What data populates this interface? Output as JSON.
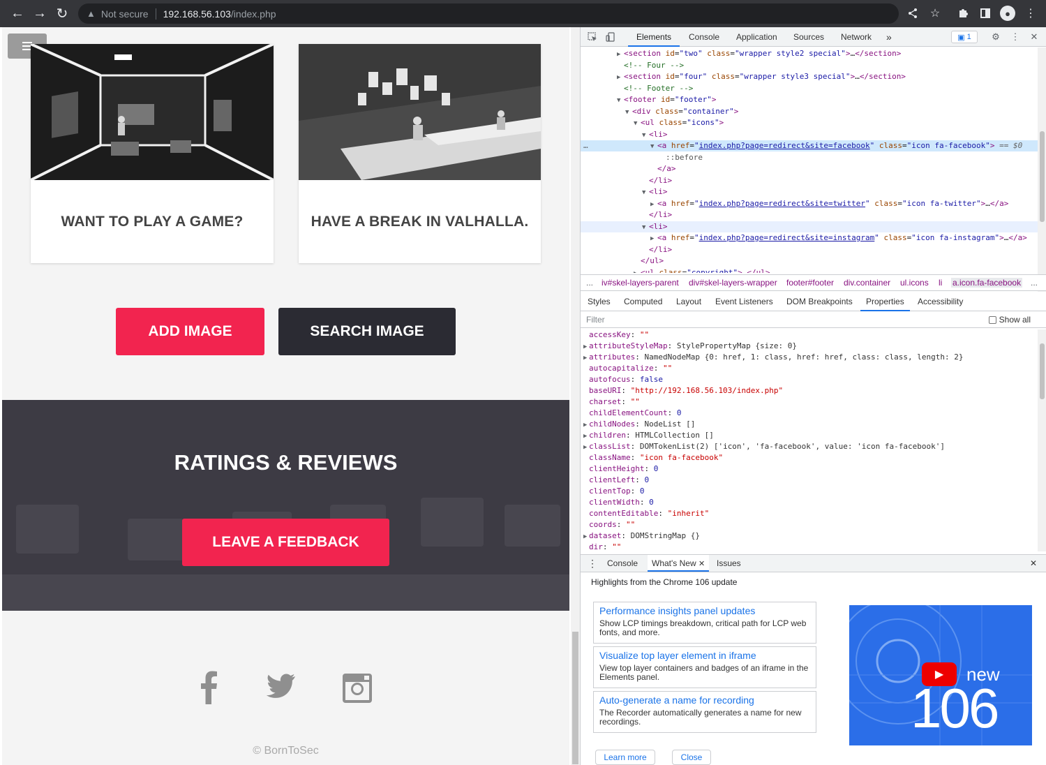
{
  "browser": {
    "security_warning": "Not secure",
    "url_host": "192.168.56.103",
    "url_path": "/index.php"
  },
  "page": {
    "cards": [
      {
        "title": "WANT TO PLAY A GAME?"
      },
      {
        "title": "HAVE A BREAK IN VALHALLA."
      }
    ],
    "add_image_label": "ADD IMAGE",
    "search_image_label": "SEARCH IMAGE",
    "reviews_title": "RATINGS & REVIEWS",
    "feedback_label": "LEAVE A FEEDBACK",
    "copyright": "© BornToSec",
    "colors": {
      "accent": "#f2244f",
      "dark": "#2b2b33"
    }
  },
  "devtools": {
    "tabs": [
      "Elements",
      "Console",
      "Application",
      "Sources",
      "Network",
      "»"
    ],
    "issues_count": "1",
    "breadcrumbs": [
      "...",
      "iv#skel-layers-parent",
      "div#skel-layers-wrapper",
      "footer#footer",
      "div.container",
      "ul.icons",
      "li",
      "a.icon.fa-facebook",
      "..."
    ],
    "subtabs": [
      "Styles",
      "Computed",
      "Layout",
      "Event Listeners",
      "DOM Breakpoints",
      "Properties",
      "Accessibility"
    ],
    "filter_placeholder": "Filter",
    "show_all": "Show all",
    "props": [
      {
        "k": "accessKey",
        "v": "\"\"",
        "t": "s",
        "exp": false
      },
      {
        "k": "attributeStyleMap",
        "v": "StylePropertyMap {size: 0}",
        "t": "o",
        "exp": true
      },
      {
        "k": "attributes",
        "v": "NamedNodeMap {0: href, 1: class, href: href, class: class, length: 2}",
        "t": "o",
        "exp": true
      },
      {
        "k": "autocapitalize",
        "v": "\"\"",
        "t": "s",
        "exp": false
      },
      {
        "k": "autofocus",
        "v": "false",
        "t": "n",
        "exp": false
      },
      {
        "k": "baseURI",
        "v": "\"http://192.168.56.103/index.php\"",
        "t": "s",
        "exp": false
      },
      {
        "k": "charset",
        "v": "\"\"",
        "t": "s",
        "exp": false
      },
      {
        "k": "childElementCount",
        "v": "0",
        "t": "n",
        "exp": false
      },
      {
        "k": "childNodes",
        "v": "NodeList []",
        "t": "o",
        "exp": true
      },
      {
        "k": "children",
        "v": "HTMLCollection []",
        "t": "o",
        "exp": true
      },
      {
        "k": "classList",
        "v": "DOMTokenList(2) ['icon', 'fa-facebook', value: 'icon fa-facebook']",
        "t": "o",
        "exp": true
      },
      {
        "k": "className",
        "v": "\"icon fa-facebook\"",
        "t": "s",
        "exp": false
      },
      {
        "k": "clientHeight",
        "v": "0",
        "t": "n",
        "exp": false
      },
      {
        "k": "clientLeft",
        "v": "0",
        "t": "n",
        "exp": false
      },
      {
        "k": "clientTop",
        "v": "0",
        "t": "n",
        "exp": false
      },
      {
        "k": "clientWidth",
        "v": "0",
        "t": "n",
        "exp": false
      },
      {
        "k": "contentEditable",
        "v": "\"inherit\"",
        "t": "s",
        "exp": false
      },
      {
        "k": "coords",
        "v": "\"\"",
        "t": "s",
        "exp": false
      },
      {
        "k": "dataset",
        "v": "DOMStringMap {}",
        "t": "o",
        "exp": true
      },
      {
        "k": "dir",
        "v": "\"\"",
        "t": "s",
        "exp": false
      }
    ],
    "drawer_tabs": [
      "Console",
      "What's New",
      "Issues"
    ],
    "whats_new_heading": "Highlights from the Chrome 106 update",
    "whats_new": [
      {
        "title": "Performance insights panel updates",
        "desc": "Show LCP timings breakdown, critical path for LCP web fonts, and more."
      },
      {
        "title": "Visualize top layer element in iframe",
        "desc": "View top layer containers and badges of an iframe in the Elements panel."
      },
      {
        "title": "Auto-generate a name for recording",
        "desc": "The Recorder automatically generates a name for new recordings."
      }
    ],
    "promo_new": "new",
    "promo_version": "106",
    "learn_more": "Learn more",
    "close": "Close"
  }
}
